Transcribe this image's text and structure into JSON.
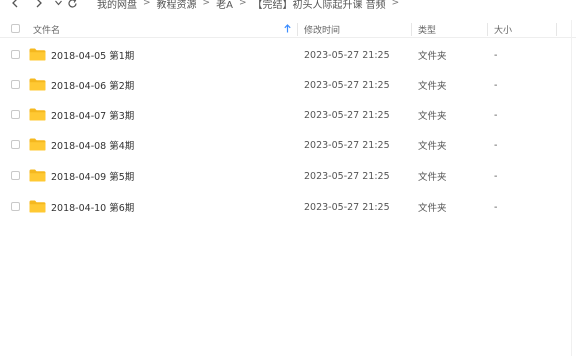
{
  "breadcrumb": [
    "我的网盘",
    "教程资源",
    "老A",
    "【完结】初头人际起升课 音频"
  ],
  "breadcrumb_separator": ">",
  "columns": {
    "name": "文件名",
    "modified": "修改时间",
    "type": "类型",
    "size": "大小"
  },
  "rows": [
    {
      "name": "2018-04-05 第1期",
      "modified": "2023-05-27 21:25",
      "type": "文件夹",
      "size": "-"
    },
    {
      "name": "2018-04-06 第2期",
      "modified": "2023-05-27 21:25",
      "type": "文件夹",
      "size": "-"
    },
    {
      "name": "2018-04-07 第3期",
      "modified": "2023-05-27 21:25",
      "type": "文件夹",
      "size": "-"
    },
    {
      "name": "2018-04-08 第4期",
      "modified": "2023-05-27 21:25",
      "type": "文件夹",
      "size": "-"
    },
    {
      "name": "2018-04-09 第5期",
      "modified": "2023-05-27 21:25",
      "type": "文件夹",
      "size": "-"
    },
    {
      "name": "2018-04-10 第6期",
      "modified": "2023-05-27 21:25",
      "type": "文件夹",
      "size": "-"
    }
  ],
  "colors": {
    "folder": "#FFC933",
    "folder_tab": "#F5B81F",
    "sort_arrow": "#3B8CFF"
  },
  "icons": {
    "back": "chevron-left-icon",
    "forward": "chevron-right-icon",
    "history": "chevron-down-icon",
    "refresh": "refresh-icon",
    "sort": "sort-up-icon",
    "folder": "folder-icon"
  }
}
